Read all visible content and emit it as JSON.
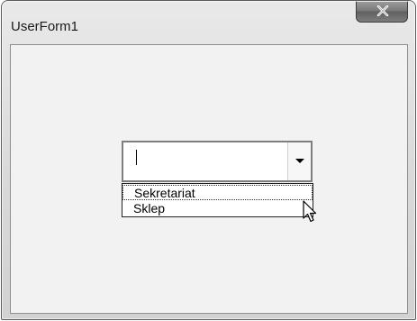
{
  "window": {
    "title": "UserForm1",
    "close_icon": "close-icon"
  },
  "combobox": {
    "value": "",
    "options": [
      "Sekretariat",
      "Sklep"
    ],
    "highlighted_index": 0
  },
  "icons": {
    "dropdown": "chevron-down-icon",
    "cursor": "mouse-pointer-icon"
  }
}
